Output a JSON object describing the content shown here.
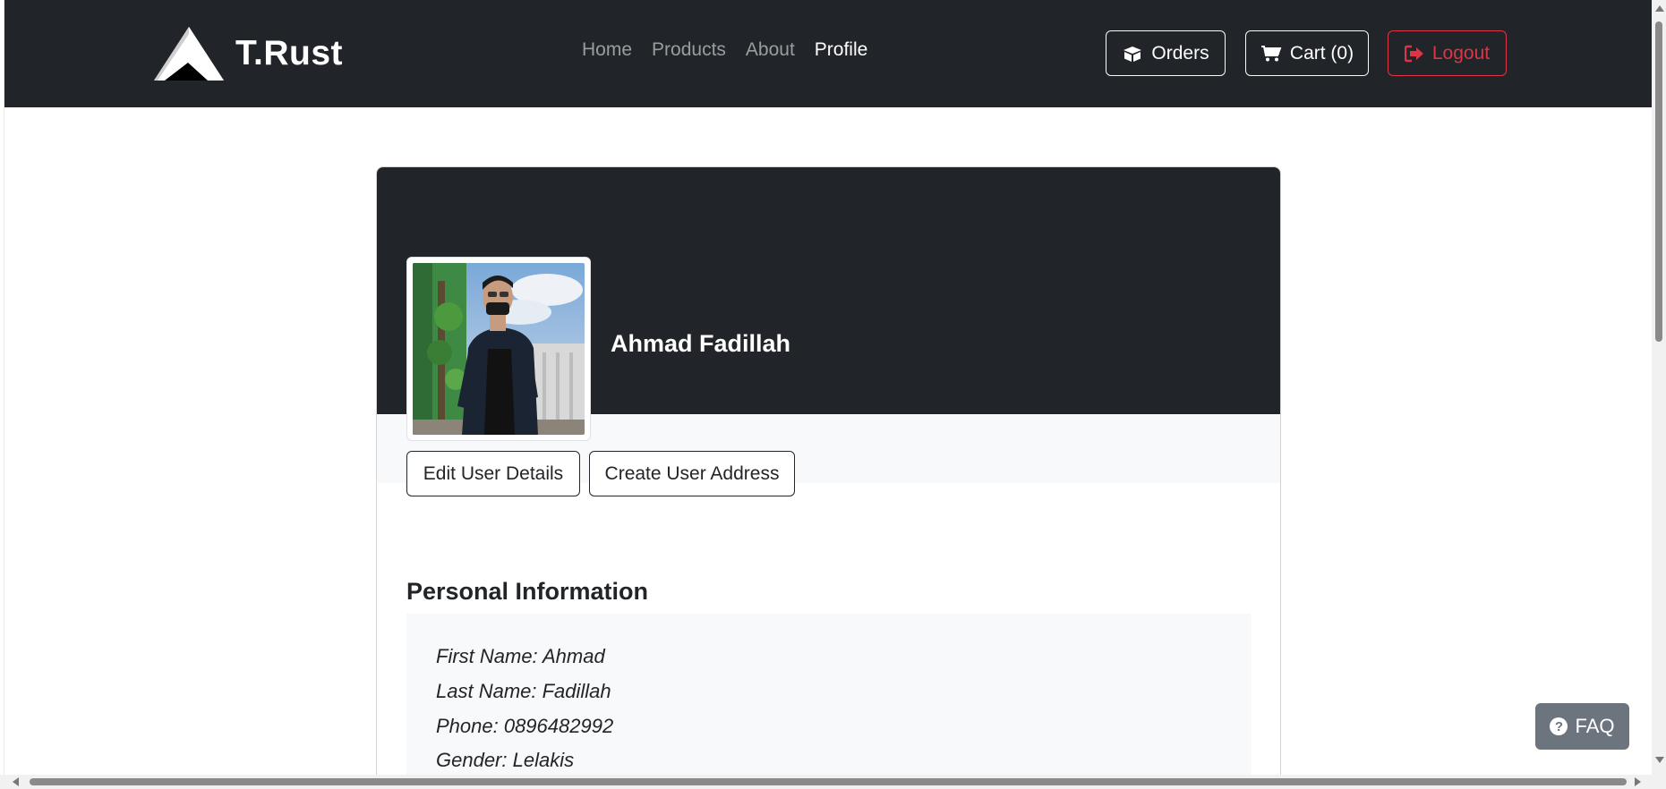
{
  "navbar": {
    "brand": "T.Rust",
    "links": [
      {
        "label": "Home",
        "active": false
      },
      {
        "label": "Products",
        "active": false
      },
      {
        "label": "About",
        "active": false
      },
      {
        "label": "Profile",
        "active": true
      }
    ],
    "orders_label": "Orders",
    "cart_label": "Cart (0)",
    "logout_label": "Logout"
  },
  "profile": {
    "name": "Ahmad Fadillah",
    "edit_button": "Edit User Details",
    "address_button": "Create User Address",
    "section_title": "Personal Information",
    "info": [
      "First Name: Ahmad",
      "Last Name: Fadillah",
      "Phone: 0896482992",
      "Gender: Lelakis"
    ]
  },
  "faq": {
    "label": "FAQ"
  },
  "colors": {
    "navbar_bg": "#212529",
    "logout": "#dc3545",
    "faq_bg": "#6c757d",
    "light_bg": "#f8f9fa"
  },
  "icons": {
    "orders": "box-icon",
    "cart": "cart-icon",
    "logout": "sign-out-icon",
    "faq": "question-circle-icon"
  }
}
